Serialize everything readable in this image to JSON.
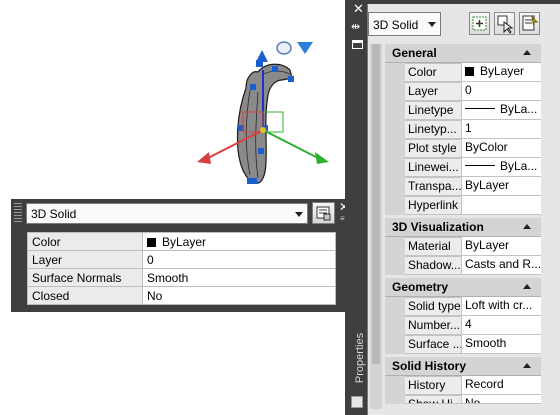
{
  "viewport": {
    "colors": {
      "x_axis": "#d84040",
      "y_axis": "#2db02d",
      "z_axis": "#2030c0",
      "solid_fill": "#7a7a7a",
      "grip": "#1a5fd0"
    }
  },
  "quick_properties": {
    "object_type": "3D Solid",
    "rows": [
      {
        "label": "Color",
        "value": "ByLayer",
        "swatch": true
      },
      {
        "label": "Layer",
        "value": "0"
      },
      {
        "label": "Surface Normals",
        "value": "Smooth"
      },
      {
        "label": "Closed",
        "value": "No"
      }
    ]
  },
  "properties_palette": {
    "title": "Properties",
    "object_type": "3D Solid",
    "sections": {
      "general": {
        "title": "General",
        "rows": [
          {
            "label": "Color",
            "value": "ByLayer"
          },
          {
            "label": "Layer",
            "value": "0"
          },
          {
            "label": "Linetype",
            "value": "ByLa..."
          },
          {
            "label": "Linetyp...",
            "value": "1"
          },
          {
            "label": "Plot style",
            "value": "ByColor"
          },
          {
            "label": "Linewei...",
            "value": "ByLa..."
          },
          {
            "label": "Transpa...",
            "value": "ByLayer"
          },
          {
            "label": "Hyperlink",
            "value": ""
          }
        ]
      },
      "visualization": {
        "title": "3D Visualization",
        "rows": [
          {
            "label": "Material",
            "value": "ByLayer"
          },
          {
            "label": "Shadow...",
            "value": "Casts and R..."
          }
        ]
      },
      "geometry": {
        "title": "Geometry",
        "rows": [
          {
            "label": "Solid type",
            "value": "Loft with cr..."
          },
          {
            "label": "Number...",
            "value": "4"
          },
          {
            "label": "Surface ...",
            "value": "Smooth"
          }
        ]
      },
      "history": {
        "title": "Solid History",
        "rows": [
          {
            "label": "History",
            "value": "Record"
          },
          {
            "label": "Show Hi...",
            "value": "No"
          }
        ]
      }
    }
  }
}
